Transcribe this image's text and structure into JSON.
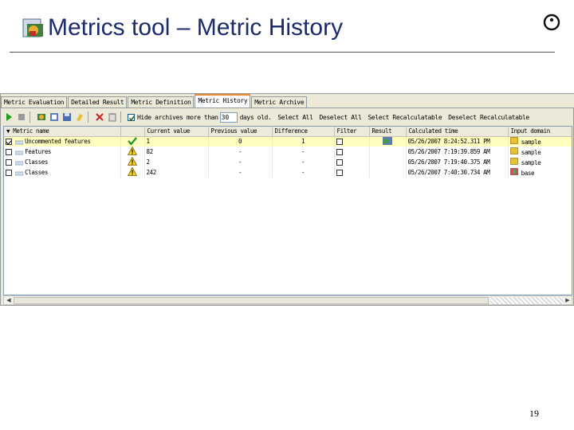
{
  "slide": {
    "title": "Metrics tool – Metric History",
    "page_number": "19"
  },
  "tabs": [
    {
      "label": "Metric Evaluation",
      "active": false
    },
    {
      "label": "Detailed Result",
      "active": false
    },
    {
      "label": "Metric Definition",
      "active": false
    },
    {
      "label": "Metric History",
      "active": true
    },
    {
      "label": "Metric Archive",
      "active": false
    }
  ],
  "toolbar": {
    "hide_archives_label": "Hide archives more than",
    "hide_archives_checked": true,
    "days_value": "30",
    "days_label": "days old.",
    "select_all": "Select All",
    "deselect_all": "Deselect All",
    "select_recalculatable": "Select Recalculatable",
    "deselect_recalculatable": "Deselect Recalculatable"
  },
  "table": {
    "columns": [
      "Metric name",
      "Current value",
      "Previous value",
      "Difference",
      "Filter",
      "Result",
      "Calculated time",
      "Input domain"
    ],
    "rows": [
      {
        "checked": true,
        "name": "Uncommented features",
        "status": "ok",
        "current": "1",
        "previous": "0",
        "difference": "1",
        "filter": "",
        "has_result": true,
        "time": "05/26/2007 8:24:52.311 PM",
        "domain": "sample",
        "selected": true
      },
      {
        "checked": false,
        "name": "Features",
        "status": "warning",
        "current": "82",
        "previous": "-",
        "difference": "-",
        "filter": "",
        "has_result": false,
        "time": "05/26/2007 7:19:39.859 AM",
        "domain": "sample",
        "selected": false
      },
      {
        "checked": false,
        "name": "Classes",
        "status": "warning",
        "current": "2",
        "previous": "-",
        "difference": "-",
        "filter": "",
        "has_result": false,
        "time": "05/26/2007 7:19:40.375 AM",
        "domain": "sample",
        "selected": false
      },
      {
        "checked": false,
        "name": "Classes",
        "status": "warning",
        "current": "242",
        "previous": "-",
        "difference": "-",
        "filter": "",
        "has_result": false,
        "time": "05/26/2007 7:40:30.734 AM",
        "domain": "base",
        "selected": false
      }
    ]
  }
}
